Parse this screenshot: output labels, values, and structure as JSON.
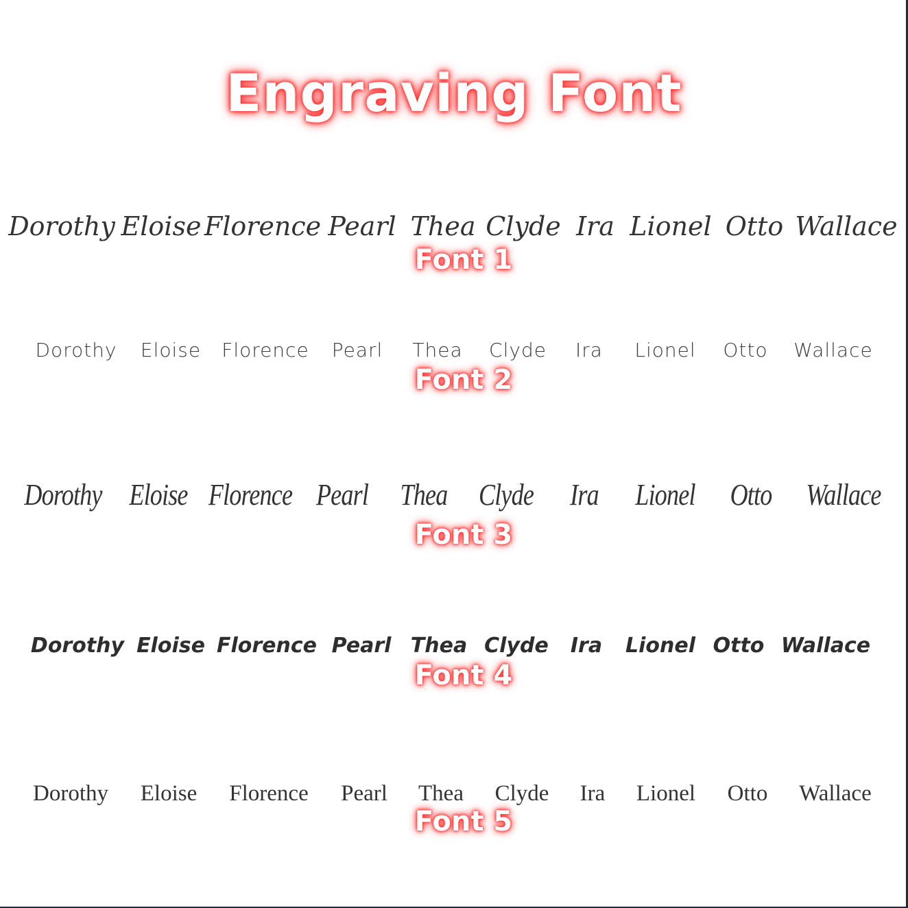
{
  "title": "Engraving Font",
  "colors": {
    "title_text": "#ffffff",
    "glow": "#ff3030",
    "sample_text": "#333333",
    "border": "#1c2a3c",
    "background": "#ffffff"
  },
  "fonts": [
    {
      "label": "Font 1",
      "style": "script with heart accents",
      "names": [
        "Dorothy",
        "Eloise",
        "Florence",
        "Pearl",
        "Thea",
        "Clyde",
        "Ira",
        "Lionel",
        "Otto",
        "Wallace"
      ]
    },
    {
      "label": "Font 2",
      "style": "thin handwritten",
      "names": [
        "Dorothy",
        "Eloise",
        "Florence",
        "Pearl",
        "Thea",
        "Clyde",
        "Ira",
        "Lionel",
        "Otto",
        "Wallace"
      ]
    },
    {
      "label": "Font 3",
      "style": "condensed calligraphy with hearts",
      "names": [
        "Dorothy",
        "Eloise",
        "Florence",
        "Pearl",
        "Thea",
        "Clyde",
        "Ira",
        "Lionel",
        "Otto",
        "Wallace"
      ]
    },
    {
      "label": "Font 4",
      "style": "bold brush",
      "names": [
        "Dorothy",
        "Eloise",
        "Florence",
        "Pearl",
        "Thea",
        "Clyde",
        "Ira",
        "Lionel",
        "Otto",
        "Wallace"
      ]
    },
    {
      "label": "Font 5",
      "style": "serif",
      "names": [
        "Dorothy",
        "Eloise",
        "Florence",
        "Pearl",
        "Thea",
        "Clyde",
        "Ira",
        "Lionel",
        "Otto",
        "Wallace"
      ]
    }
  ]
}
